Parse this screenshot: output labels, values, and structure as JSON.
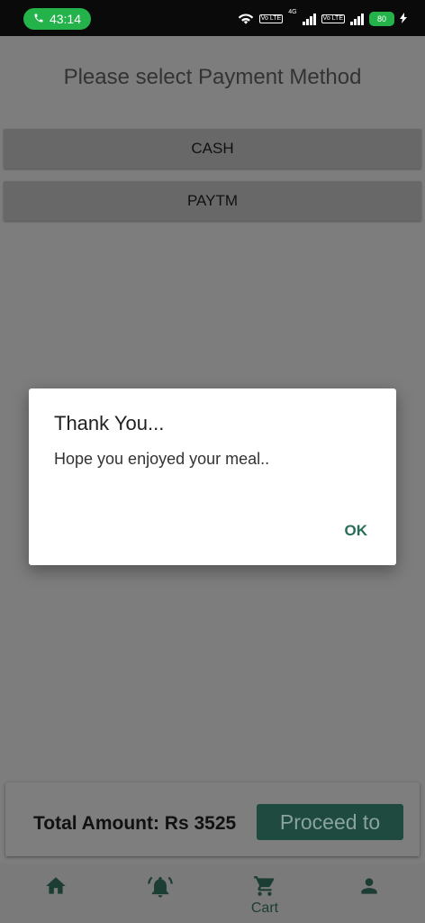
{
  "status_bar": {
    "call_time": "43:14",
    "network_type": "4G",
    "volte_label": "Vo LTE",
    "battery": "80"
  },
  "page": {
    "title": "Please select Payment Method",
    "payment_methods": [
      "CASH",
      "PAYTM"
    ]
  },
  "summary": {
    "total_text": "Total Amount: Rs 3525",
    "proceed_label": "Proceed to"
  },
  "bottom_nav": {
    "items": [
      {
        "icon": "home-icon",
        "label": ""
      },
      {
        "icon": "bell-icon",
        "label": ""
      },
      {
        "icon": "cart-icon",
        "label": "Cart"
      },
      {
        "icon": "person-icon",
        "label": ""
      }
    ]
  },
  "dialog": {
    "title": "Thank You...",
    "message": "Hope you enjoyed your meal..",
    "ok_label": "OK"
  },
  "colors": {
    "accent": "#2b6d5b",
    "call_green": "#23b34a",
    "proceed_bg": "#1e4a3f"
  }
}
